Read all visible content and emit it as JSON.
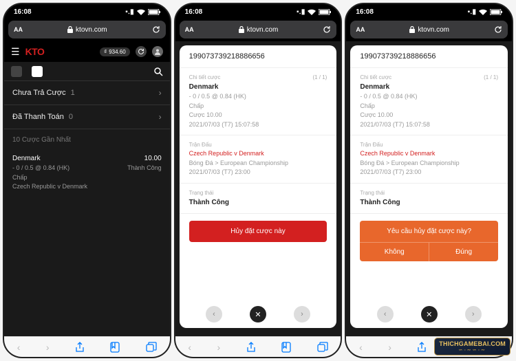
{
  "statusbar": {
    "time": "16:08"
  },
  "address": {
    "aa": "AA",
    "domain": "ktovn.com"
  },
  "app": {
    "logo": "KTO",
    "balance_currency": "₫",
    "balance_value": "934.60"
  },
  "betlist": {
    "pending_label": "Chưa Trả Cược",
    "pending_count": "1",
    "settled_label": "Đã Thanh Toán",
    "settled_count": "0",
    "recent_label": "10 Cược Gần Nhất",
    "card": {
      "team": "Denmark",
      "odds": "- 0 / 0.5 @ 0.84 (HK)",
      "market": "Chấp",
      "match": "Czech Republic v Denmark",
      "amount": "10.00",
      "status": "Thành Công"
    }
  },
  "detail": {
    "bet_id": "199073739218886656",
    "bet_section_label": "Chi tiết cược",
    "page_indicator": "(1 / 1)",
    "team": "Denmark",
    "odds": "- 0 / 0.5 @ 0.84 (HK)",
    "market": "Chấp",
    "stake": "Cược 10.00",
    "placed_time": "2021/07/03 (T7) 15:07:58",
    "match_section_label": "Trận Đấu",
    "match": "Czech Republic v Denmark",
    "league": "Bóng Đá > European Championship",
    "match_time": "2021/07/03 (T7) 23:00",
    "status_section_label": "Trạng thái",
    "status_value": "Thành Công",
    "cancel_button": "Hủy đặt cược này",
    "confirm_question": "Yêu cầu hủy đặt cược này?",
    "confirm_no": "Không",
    "confirm_yes": "Đúng"
  },
  "watermark": "THICHGAMEBAI.COM"
}
